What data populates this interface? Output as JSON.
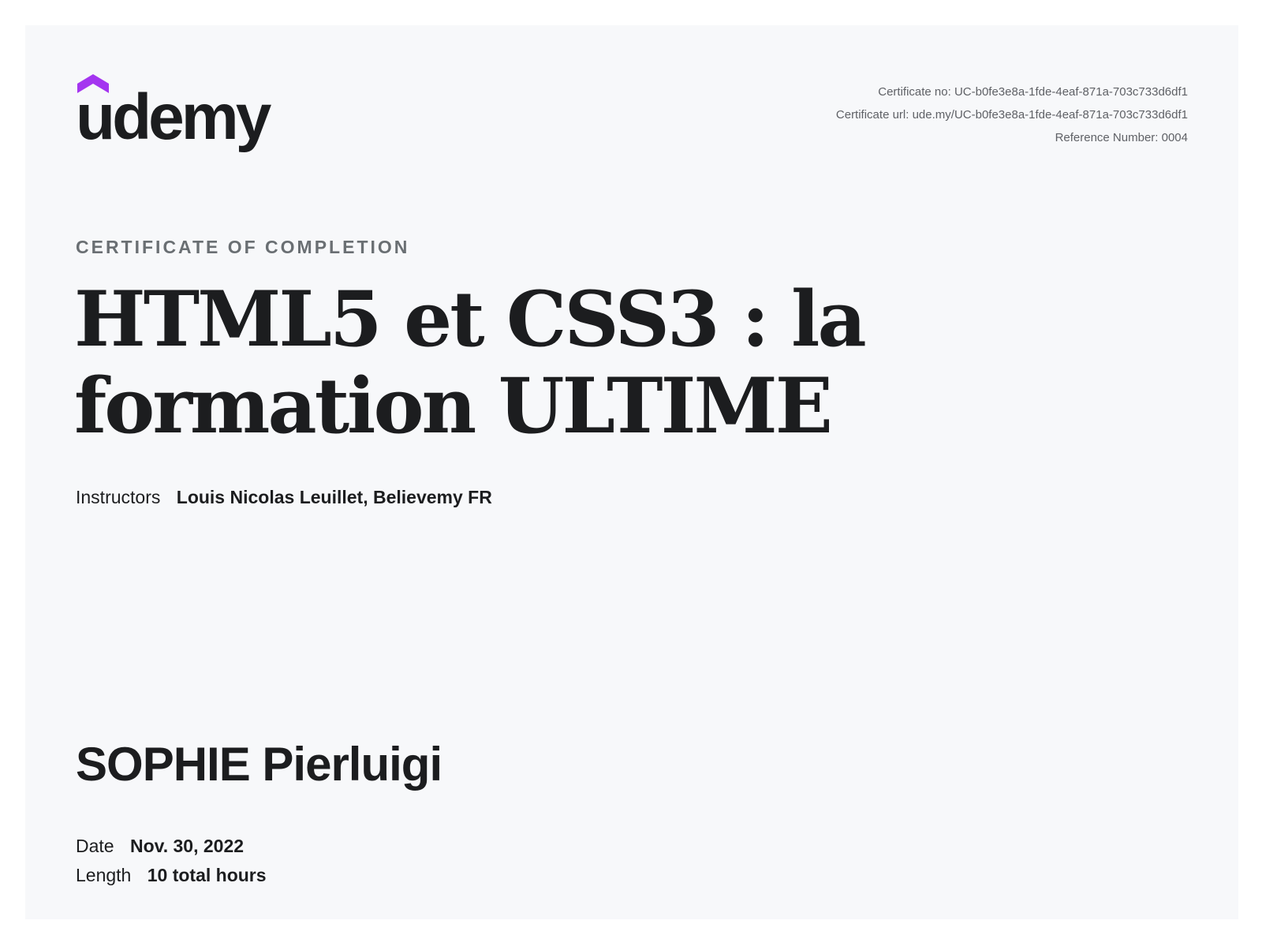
{
  "brand": {
    "logo_text": "udemy",
    "accent_color": "#a435f0",
    "icon": "udemy-cap-icon"
  },
  "certificate": {
    "number_label": "Certificate no: UC-b0fe3e8a-1fde-4eaf-871a-703c733d6df1",
    "url_label": "Certificate url: ude.my/UC-b0fe3e8a-1fde-4eaf-871a-703c733d6df1",
    "reference_label": "Reference Number: 0004"
  },
  "heading": "CERTIFICATE OF COMPLETION",
  "course": {
    "title": "HTML5 et CSS3 : la formation ULTIME",
    "instructors_label": "Instructors",
    "instructors": "Louis Nicolas Leuillet,  Believemy FR"
  },
  "student": {
    "name": "SOPHIE Pierluigi"
  },
  "details": {
    "date_label": "Date",
    "date_value": "Nov. 30, 2022",
    "length_label": "Length",
    "length_value": "10 total hours"
  }
}
